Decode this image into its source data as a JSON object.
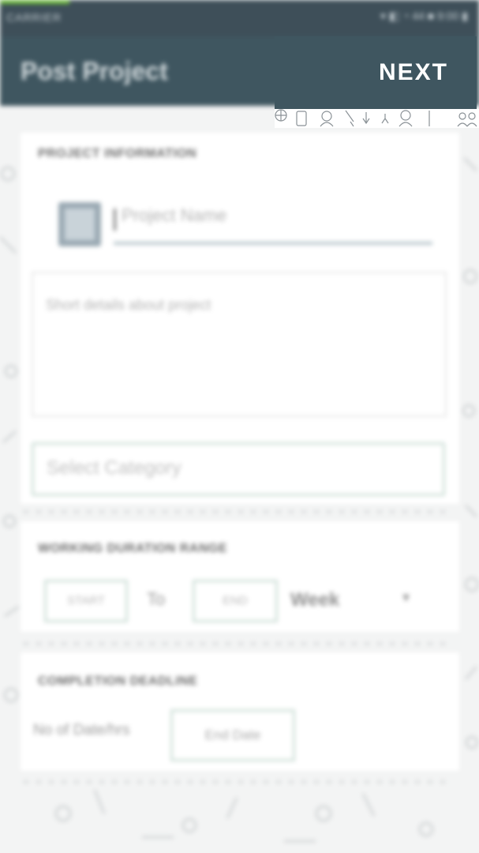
{
  "status_bar": {
    "left_text": "CARRIER",
    "right_text": "▾ ◧ ◔ 44 ■ 9:00 ▮"
  },
  "app_bar": {
    "title": "Post Project",
    "next_label": "NEXT"
  },
  "project_info": {
    "section_label": "PROJECT INFORMATION",
    "name_placeholder": "Project Name",
    "details_placeholder": "Short details about project",
    "category_placeholder": "Select Category"
  },
  "working_duration": {
    "section_label": "WORKING DURATION RANGE",
    "start_label": "START",
    "to_label": "To",
    "end_label": "END",
    "unit_value": "Week"
  },
  "completion": {
    "section_label": "COMPLETION DEADLINE",
    "no_of_days_label": "No of Date/hrs",
    "end_date_label": "End Date"
  },
  "colors": {
    "app_bar": "#3f5660",
    "status_bar": "#3e4f59",
    "accent_border": "#cfe0d8",
    "background": "#f3f4f4"
  }
}
